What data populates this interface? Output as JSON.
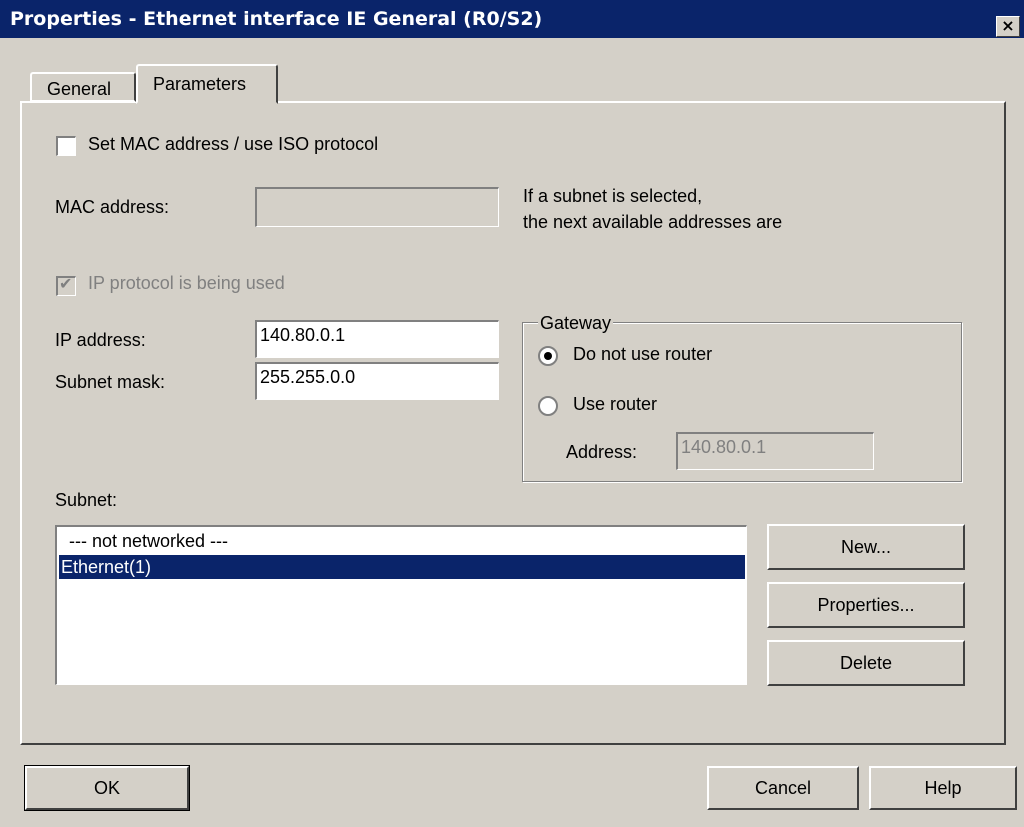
{
  "window": {
    "title": "Properties - Ethernet interface  IE General (R0/S2)",
    "close_label": "×"
  },
  "tabs": [
    {
      "label": "General",
      "active": false
    },
    {
      "label": "Parameters",
      "active": true
    }
  ],
  "mac": {
    "checkbox_label": "Set MAC address / use ISO protocol",
    "checked": false,
    "address_label": "MAC address:",
    "address_value": "",
    "hint_line1": "If a subnet is selected,",
    "hint_line2": "the next available addresses are"
  },
  "ip": {
    "protocol_label": "IP protocol is being used",
    "protocol_checked": true,
    "address_label": "IP address:",
    "address_value": "140.80.0.1",
    "mask_label": "Subnet mask:",
    "mask_value": "255.255.0.0"
  },
  "gateway": {
    "title": "Gateway",
    "no_router_label": "Do not use router",
    "use_router_label": "Use router",
    "selected": "no_router",
    "address_label": "Address:",
    "address_value": "140.80.0.1"
  },
  "subnet": {
    "label": "Subnet:",
    "items": [
      {
        "label": "--- not networked ---",
        "selected": false
      },
      {
        "label": "Ethernet(1)",
        "selected": true
      }
    ],
    "buttons": {
      "new": "New...",
      "properties": "Properties...",
      "delete": "Delete"
    }
  },
  "footer": {
    "ok": "OK",
    "cancel": "Cancel",
    "help": "Help"
  },
  "colors": {
    "titlebar": "#0a246a",
    "face": "#d4d0c8",
    "selection": "#0a246a"
  }
}
